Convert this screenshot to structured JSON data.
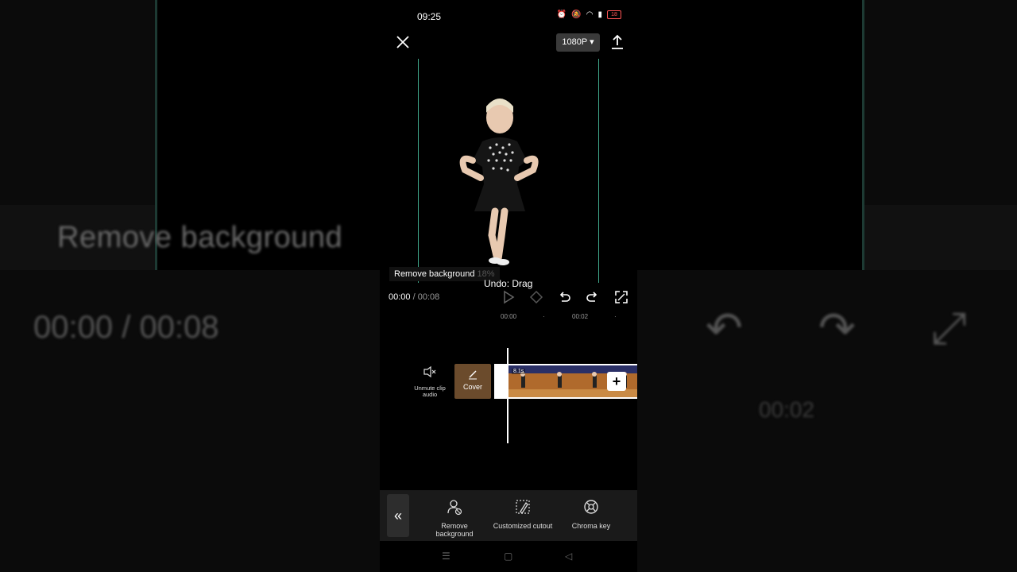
{
  "background": {
    "remove_text": "Remove background",
    "time_text": "00:00 / 00:08",
    "time2_text": "00:02"
  },
  "status_bar": {
    "time": "09:25",
    "battery": "18"
  },
  "topbar": {
    "resolution": "1080P ▾"
  },
  "preview": {
    "toast_text": "Remove background",
    "toast_percent": "18%",
    "undo_text": "Undo: Drag"
  },
  "playback": {
    "current_time": "00:00",
    "total_time": "/ 00:08"
  },
  "timeline": {
    "ruler": [
      "00:00",
      "·",
      "00:02",
      "·"
    ],
    "mute_label": "Unmute clip audio",
    "cover_label": "Cover",
    "clip_duration": "8.1s",
    "add_label": "+"
  },
  "toolbar": {
    "back_label": "«",
    "tools": [
      {
        "label": "Remove background",
        "icon": "remove-background-icon"
      },
      {
        "label": "Customized cutout",
        "icon": "customized-cutout-icon"
      },
      {
        "label": "Chroma key",
        "icon": "chroma-key-icon"
      }
    ]
  },
  "navbar": {
    "menu": "☰",
    "home": "▢",
    "back": "◁"
  },
  "colors": {
    "accent": "#3fa68a",
    "panel": "#1a1a1a"
  }
}
